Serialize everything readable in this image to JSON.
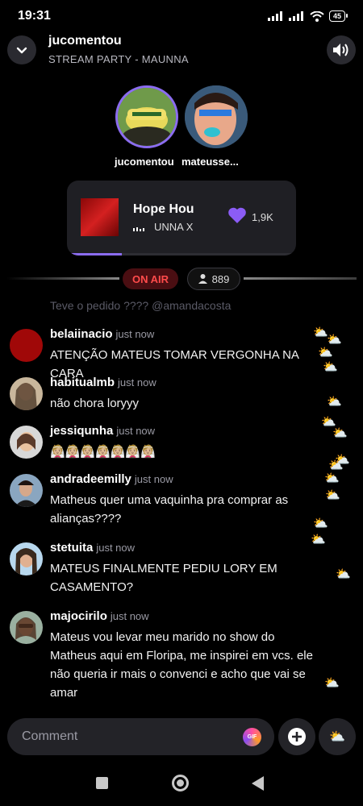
{
  "status": {
    "time": "19:31",
    "battery": "45"
  },
  "header": {
    "username": "jucomentou",
    "subtitle": "STREAM PARTY - MAUNNA"
  },
  "participants": [
    {
      "name": "jucomentou"
    },
    {
      "name": "mateusse..."
    }
  ],
  "now_playing": {
    "title": "Hope       Hou",
    "artist": "UNNA X",
    "likes": "1,9K",
    "progress": 0.24
  },
  "live": {
    "on_air": "ON AIR",
    "viewers": "889"
  },
  "faded_comment": "Teve o pedido ???? @amandacosta",
  "comments": [
    {
      "user": "belaiinacio",
      "time": "just now",
      "text": "ATENÇÃO MATEUS TOMAR VERGONHA NA CARA"
    },
    {
      "user": "habitualmb",
      "time": "just now",
      "text": "não chora loryyy"
    },
    {
      "user": "jessiqunha",
      "time": "just now",
      "text": "👰🏼👰🏼👰🏼👰🏼👰🏼👰🏼👰🏼"
    },
    {
      "user": "andradeemilly",
      "time": "just now",
      "text": "Matheus quer uma vaquinha pra comprar as alianças????"
    },
    {
      "user": "stetuita",
      "time": "just now",
      "text": "MATEUS FINALMENTE PEDIU LORY EM CASAMENTO?"
    },
    {
      "user": "majocirilo",
      "time": "just now",
      "text": "Mateus vou levar meu marido no show do Matheus aqui em Floripa, me inspirei em vcs. ele não queria ir mais o convenci e acho que vai se amar"
    }
  ],
  "composer": {
    "placeholder": "Comment",
    "gif": "GIF"
  },
  "icons": [
    "chevron-down-icon",
    "volume-icon",
    "heart-icon",
    "equalizer-icon",
    "person-icon",
    "plus-icon",
    "sun-cloud-icon",
    "nav-square-icon",
    "nav-home-icon",
    "nav-back-icon"
  ],
  "colors": {
    "accent": "#8b6cf0",
    "on_air": "#ff4b4b",
    "background": "#000000"
  }
}
